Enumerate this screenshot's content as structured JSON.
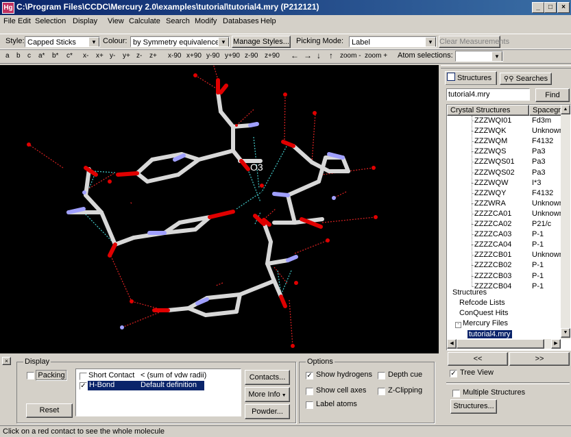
{
  "window": {
    "title": "C:\\Program Files\\CCDC\\Mercury 2.0\\examples\\tutorial\\tutorial4.mry (P212121)",
    "app_icon": "Hg",
    "minimize": "_",
    "maximize": "□",
    "close": "×"
  },
  "menu": [
    "File",
    "Edit",
    "Selection",
    "Display",
    "View",
    "Calculate",
    "Search",
    "Modify",
    "Databases",
    "Help"
  ],
  "toolbar1": {
    "style_label": "Style:",
    "style_value": "Capped Sticks",
    "colour_label": "Colour:",
    "colour_value": "by Symmetry equivalence",
    "manage_styles": "Manage Styles...",
    "picking_label": "Picking Mode:",
    "picking_value": "Label",
    "clear_measurements": "Clear Measurements"
  },
  "toolbar2": {
    "buttons": [
      "a",
      "b",
      "c",
      "a*",
      "b*",
      "c*",
      "x-",
      "x+",
      "y-",
      "y+",
      "z-",
      "z+",
      "x-90",
      "x+90",
      "y-90",
      "y+90",
      "z-90",
      "z+90",
      "←",
      "→",
      "↓",
      "↑",
      "zoom -",
      "zoom +"
    ],
    "atom_selections_label": "Atom selections:"
  },
  "viewer": {
    "atom_label": "O3"
  },
  "right_panel": {
    "tabs": [
      "Structures",
      "Searches"
    ],
    "search_value": "tutorial4.mry",
    "find_button": "Find",
    "col_headers": [
      "Crystal Structures",
      "Spacegr"
    ],
    "rows": [
      {
        "name": "ZZZWQI01",
        "sg": "Fd3m"
      },
      {
        "name": "ZZZWQK",
        "sg": "Unknown"
      },
      {
        "name": "ZZZWQM",
        "sg": "F4132"
      },
      {
        "name": "ZZZWQS",
        "sg": "Pa3"
      },
      {
        "name": "ZZZWQS01",
        "sg": "Pa3"
      },
      {
        "name": "ZZZWQS02",
        "sg": "Pa3"
      },
      {
        "name": "ZZZWQW",
        "sg": "I*3"
      },
      {
        "name": "ZZZWQY",
        "sg": "F4132"
      },
      {
        "name": "ZZZWRA",
        "sg": "Unknown"
      },
      {
        "name": "ZZZZCA01",
        "sg": "Unknown"
      },
      {
        "name": "ZZZZCA02",
        "sg": "P21/c"
      },
      {
        "name": "ZZZZCA03",
        "sg": "P-1"
      },
      {
        "name": "ZZZZCA04",
        "sg": "P-1"
      },
      {
        "name": "ZZZZCB01",
        "sg": "Unknown"
      },
      {
        "name": "ZZZZCB02",
        "sg": "P-1"
      },
      {
        "name": "ZZZZCB03",
        "sg": "P-1"
      },
      {
        "name": "ZZZZCB04",
        "sg": "P-1"
      }
    ],
    "tree_nodes": [
      "Structures",
      "Refcode Lists",
      "ConQuest Hits",
      "Mercury Files",
      "tutorial4.mry"
    ],
    "prev_button": "<<",
    "next_button": ">>",
    "tree_view_label": "Tree View",
    "multiple_structures_label": "Multiple Structures",
    "structures_button": "Structures..."
  },
  "display_panel": {
    "title": "Display",
    "packing_label": "Packing",
    "reset_button": "Reset",
    "contacts": [
      {
        "checked": false,
        "name": "Short Contact",
        "desc": "< (sum of vdw radii)"
      },
      {
        "checked": true,
        "name": "H-Bond",
        "desc": "Default definition"
      }
    ],
    "contacts_button": "Contacts...",
    "more_info_button": "More Info",
    "powder_button": "Powder..."
  },
  "options_panel": {
    "title": "Options",
    "show_hydrogens": "Show hydrogens",
    "depth_cue": "Depth cue",
    "show_cell_axes": "Show cell axes",
    "z_clipping": "Z-Clipping",
    "label_atoms": "Label atoms"
  },
  "status": "Click on a red contact to see the whole molecule",
  "colors": {
    "title_start": "#0a246a",
    "title_end": "#3a6ea5",
    "face": "#d4d0c8",
    "selection": "#0a246a",
    "oxygen": "#e00000",
    "nitrogen": "#a0a0ff",
    "carbon": "#d8d8d8",
    "hbond": "#40c0c0"
  }
}
